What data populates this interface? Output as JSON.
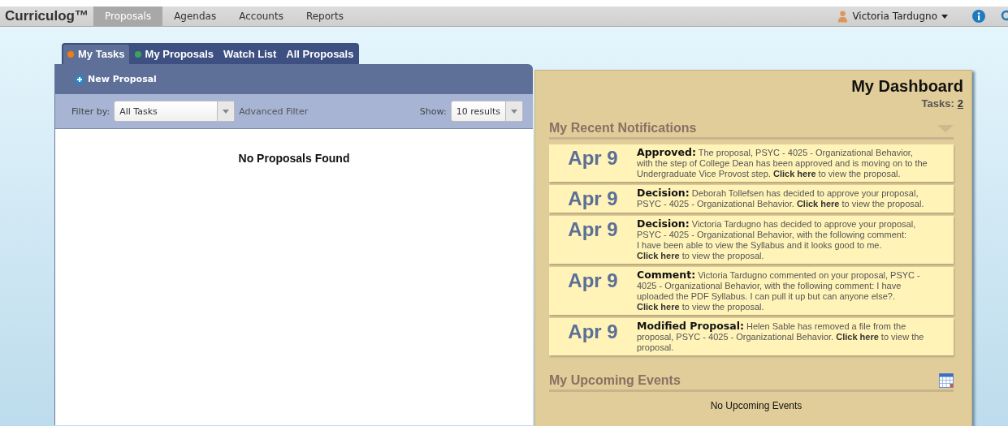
{
  "app": {
    "logo": "Curriculog™"
  },
  "nav": [
    {
      "label": "Proposals",
      "selected": true
    },
    {
      "label": "Agendas",
      "selected": false
    },
    {
      "label": "Accounts",
      "selected": false
    },
    {
      "label": "Reports",
      "selected": false
    }
  ],
  "user": {
    "name": "Victoria Tardugno"
  },
  "tabs": [
    {
      "label": "My Tasks",
      "selected": true,
      "color": "#f07d12"
    },
    {
      "label": "My Proposals",
      "selected": false,
      "color": "#3aa55a"
    },
    {
      "label": "Watch List",
      "selected": false
    },
    {
      "label": "All Proposals",
      "selected": false
    }
  ],
  "new_button": {
    "label": "New Proposal"
  },
  "filter": {
    "label": "Filter by:",
    "value": "All Tasks",
    "advanced": "Advanced Filter",
    "show_label": "Show:",
    "show_value": "10 results"
  },
  "empty_message": "No Proposals Found",
  "dashboard": {
    "title": "My Dashboard",
    "tasks_label": "Tasks:",
    "tasks_count": "2",
    "notifications_title": "My Recent Notifications",
    "notifications": [
      {
        "date": "Apr 9",
        "label": "Approved:",
        "text": "The proposal, PSYC - 4025 - Organizational Behavior, with the step of College Dean has been approved and is moving on to the Undergraduate Vice Provost step.",
        "link": "Click here",
        "after": "to view the proposal."
      },
      {
        "date": "Apr 9",
        "label": "Decision:",
        "text": "Deborah Tollefsen has decided to approve your proposal, PSYC - 4025 - Organizational Behavior.",
        "link": "Click here",
        "after": "to view the proposal."
      },
      {
        "date": "Apr 9",
        "label": "Decision:",
        "text": "Victoria Tardugno has decided to approve your proposal, PSYC - 4025 - Organizational Behavior, with the following comment:\nI have been able to view the Syllabus and it looks good to me.\n",
        "link": "Click here",
        "after": "to view the proposal."
      },
      {
        "date": "Apr 9",
        "label": "Comment:",
        "text": "Victoria Tardugno commented on your proposal, PSYC - 4025 - Organizational Behavior, with the following comment: I have uploaded the PDF Syllabus. I can pull it up but can anyone else?.",
        "link": "Click here",
        "after": "to view the proposal."
      },
      {
        "date": "Apr 9",
        "label": "Modified Proposal:",
        "text": "Helen Sable has removed a file from the proposal, PSYC - 4025 - Organizational Behavior.",
        "link": "Click here",
        "after": "to view the proposal."
      }
    ],
    "events_title": "My Upcoming Events",
    "events_empty": "No Upcoming Events"
  }
}
